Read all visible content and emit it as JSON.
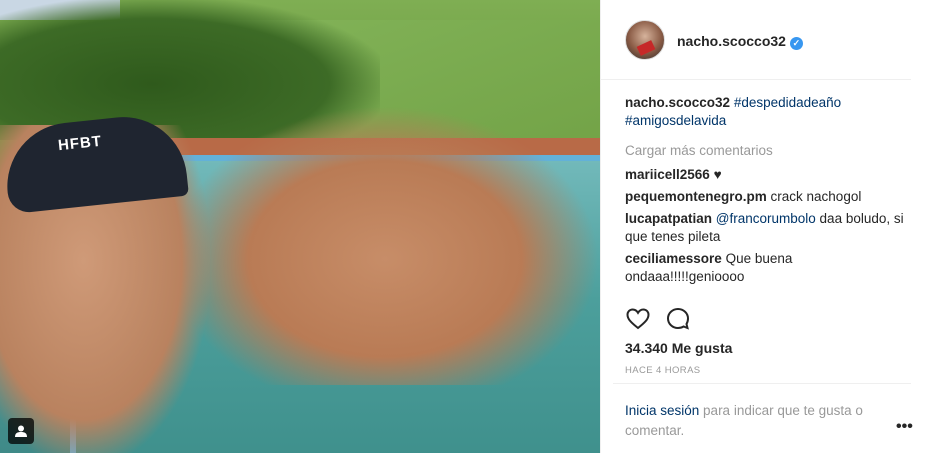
{
  "photo": {
    "cap_text": "HFBT"
  },
  "post": {
    "username": "nacho.scocco32",
    "caption_hashtags": [
      "#despedidadeaño",
      "#amigosdelavida"
    ],
    "load_more_label": "Cargar más comentarios",
    "comments": [
      {
        "user": "mariicell2566",
        "text": "♥"
      },
      {
        "user": "pequemontenegro.pm",
        "text": "crack nachogol"
      },
      {
        "user": "lucapatpatian",
        "mention": "@francorumbolo",
        "text": " daa boludo, si que tenes pileta"
      },
      {
        "user": "ceciliamessore",
        "text": "Que buena ondaaa!!!!!genioooo"
      }
    ],
    "likes_label": "34.340 Me gusta",
    "timestamp": "HACE 4 HORAS",
    "login_link": "Inicia sesión",
    "login_text": " para indicar que te gusta o comentar.",
    "more_label": "•••"
  },
  "colors": {
    "link": "#003569",
    "muted": "#999999",
    "verified": "#3897f0"
  }
}
